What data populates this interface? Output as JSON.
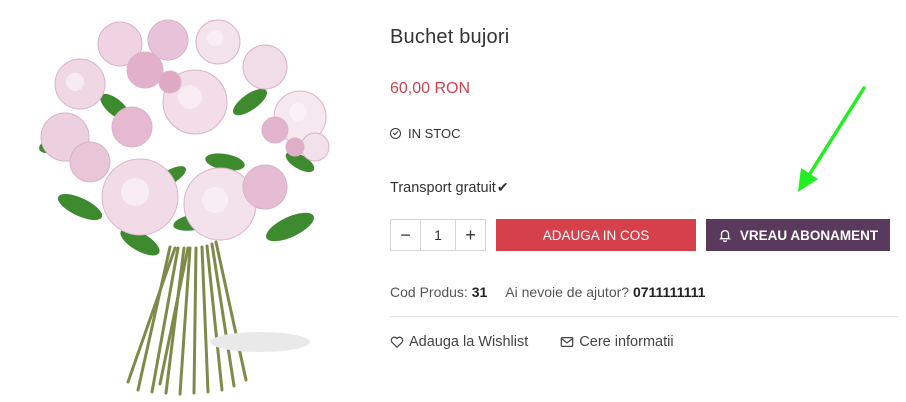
{
  "product": {
    "title": "Buchet bujori",
    "price": "60,00 RON",
    "stock": "IN STOC",
    "shipping": "Transport gratuit",
    "shipping_mark": "✔"
  },
  "cart": {
    "minus": "−",
    "quantity": "1",
    "plus": "+",
    "add_to_cart": "ADAUGA IN COS",
    "subscribe": "VREAU ABONAMENT"
  },
  "meta": {
    "code_label": "Cod Produs:",
    "code_value": "31",
    "help_label": "Ai nevoie de ajutor?",
    "help_phone": "0711111111"
  },
  "links": {
    "wishlist": "Adauga la Wishlist",
    "info": "Cere informatii"
  },
  "colors": {
    "accent_red": "#d5404b",
    "subscribe_purple": "#5a3a5c",
    "annotation_arrow": "#22ee22"
  },
  "icons": [
    "check-circle-icon",
    "checkmark-icon",
    "bell-icon",
    "heart-icon",
    "envelope-icon",
    "green-arrow-annotation"
  ]
}
